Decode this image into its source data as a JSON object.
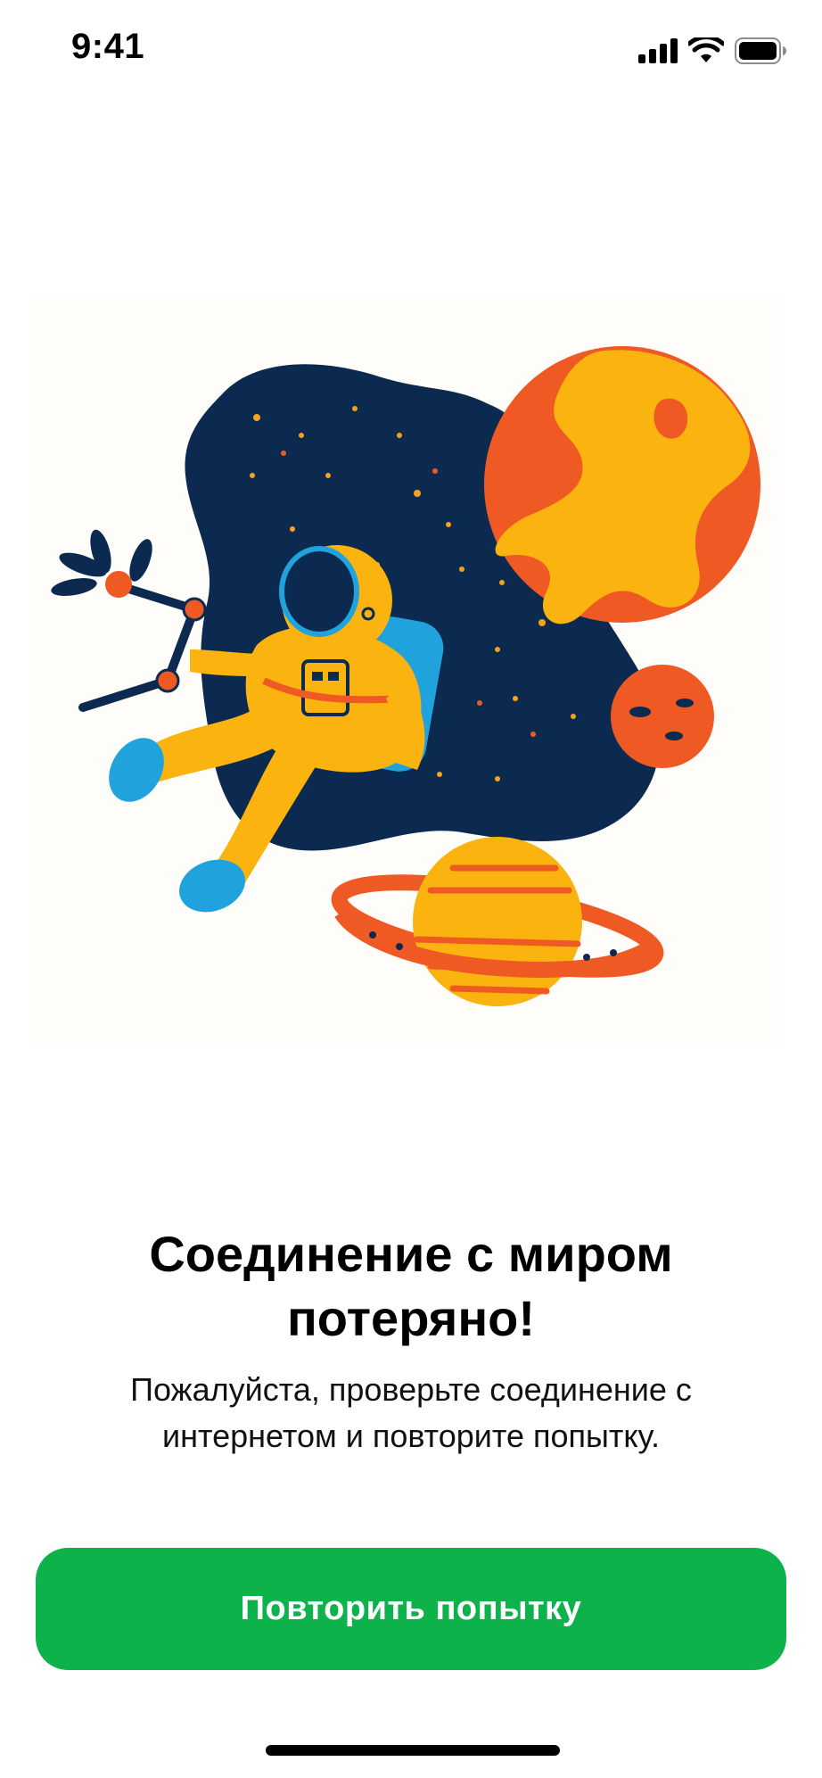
{
  "status_bar": {
    "time": "9:41",
    "icons": [
      "cellular-signal-icon",
      "wifi-icon",
      "battery-icon"
    ]
  },
  "illustration": {
    "subject": "astronaut-in-space-illustration",
    "colors": {
      "space": "#0c2a4f",
      "suit": "#fbb40f",
      "accent": "#ef5a24",
      "visor": "#0c2a4f",
      "boot": "#20a3dc"
    }
  },
  "error": {
    "title": "Соединение с миром потеряно!",
    "message": "Пожалуйста, проверьте соединение с интернетом и повторите попытку."
  },
  "actions": {
    "retry_label": "Повторить попытку"
  },
  "theme": {
    "accent": "#0db24a",
    "background": "#ffffff",
    "text": "#000000"
  }
}
